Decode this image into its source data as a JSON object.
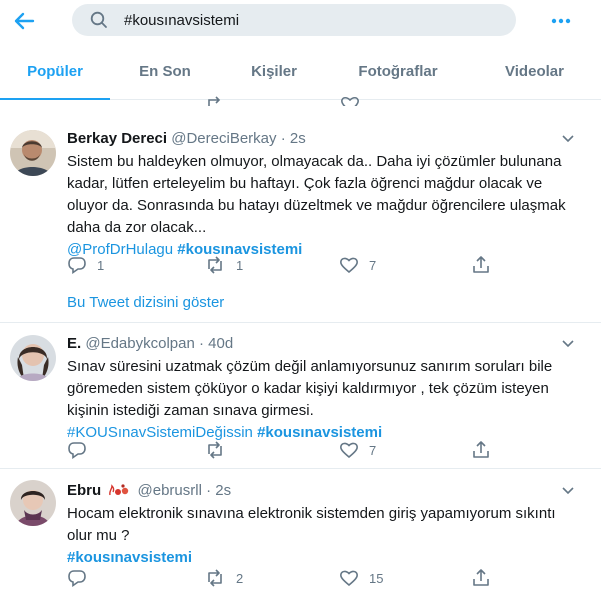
{
  "search": {
    "query": "#kousınavsistemi"
  },
  "tabs": [
    {
      "label": "Popüler"
    },
    {
      "label": "En Son"
    },
    {
      "label": "Kişiler"
    },
    {
      "label": "Fotoğraflar"
    },
    {
      "label": "Videolar"
    }
  ],
  "tweets": [
    {
      "name": "Berkay Dereci",
      "handle": "@DereciBerkay",
      "sep": "·",
      "time": "2s",
      "lines": [
        "Sistem bu haldeyken olmuyor, olmayacak da..  Daha iyi çözümler bulunana",
        "kadar, lütfen erteleyelim bu haftayı. Çok fazla öğrenci mağdur olacak ve",
        "oluyor da. Sonrasında bu hatayı düzeltmek ve mağdur öğrencilere ulaşmak",
        "daha da zor olacak..."
      ],
      "mention": "@ProfDrHulagu",
      "hashtag": "#kousınavsistemi",
      "replies": "1",
      "retweets": "1",
      "likes": "7",
      "thread_label": "Bu Tweet dizisini göster"
    },
    {
      "name": "E.",
      "handle": "@Edabykcolpan",
      "sep": "·",
      "time": "40d",
      "lines": [
        "Sınav süresini uzatmak çözüm değil anlamıyorsunuz sanırım soruları bile",
        "göremeden sistem çöküyor o kadar kişiyi kaldırmıyor , tek çözüm isteyen",
        "kişinin istediği zaman sınava girmesi."
      ],
      "hashtag1": "#KOUSınavSistemiDeğissin",
      "hashtag2": "#kousınavsistemi",
      "replies": "",
      "retweets": "",
      "likes": "7"
    },
    {
      "name": "Ebru",
      "handle": "@ebrusrll",
      "sep": "·",
      "time": "2s",
      "lines": [
        "Hocam elektronik sınavına elektronik sistemden giriş yapamıyorum sıkıntı",
        "olur mu ?"
      ],
      "hashtag": "#kousınavsistemi",
      "replies": "",
      "retweets": "2",
      "likes": "15"
    }
  ],
  "colors": {
    "accent": "#1da1f2",
    "link": "#1b95e0",
    "secondary_text": "#657786",
    "divider": "#e6ecf0"
  },
  "icons": [
    "back-arrow-icon",
    "search-icon",
    "more-icon",
    "caret-down-icon",
    "reply-icon",
    "retweet-icon",
    "like-icon",
    "share-icon",
    "flame-icon"
  ]
}
